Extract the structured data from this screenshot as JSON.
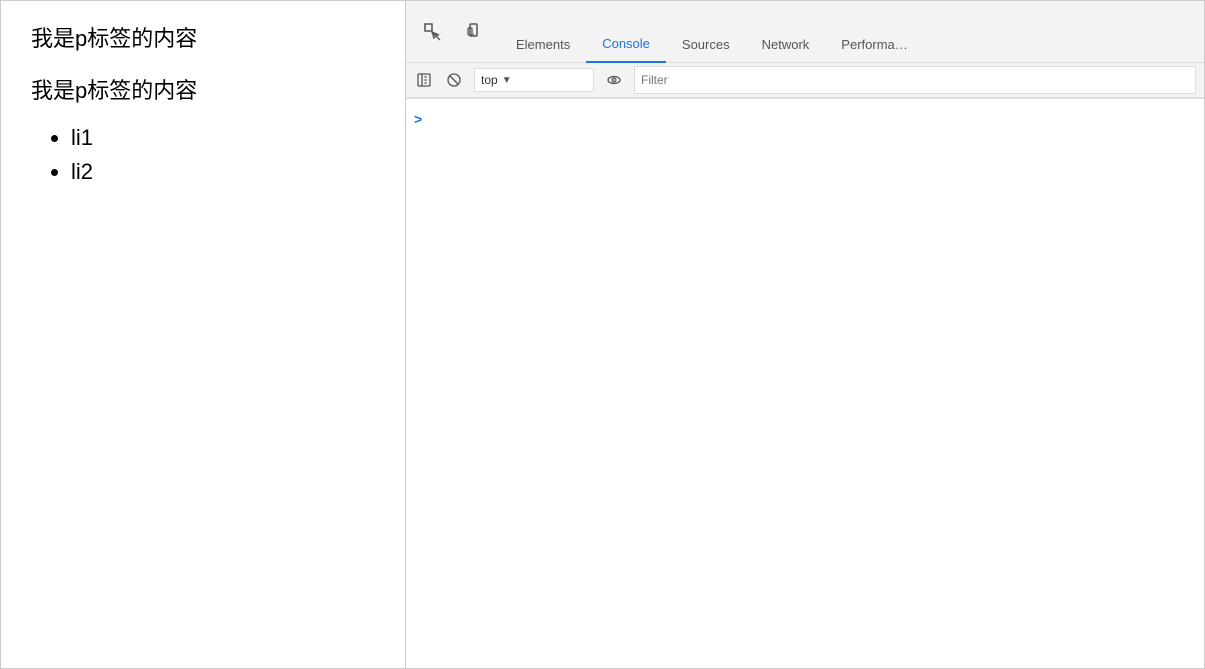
{
  "webpage": {
    "paragraph1": "我是p标签的内容",
    "paragraph2": "我是p标签的内容",
    "list_items": [
      "li1",
      "li2"
    ]
  },
  "devtools": {
    "tabs": [
      {
        "id": "elements",
        "label": "Elements",
        "active": false
      },
      {
        "id": "console",
        "label": "Console",
        "active": true
      },
      {
        "id": "sources",
        "label": "Sources",
        "active": false
      },
      {
        "id": "network",
        "label": "Network",
        "active": false
      },
      {
        "id": "performance",
        "label": "Performa…",
        "active": false
      }
    ],
    "toolbar2": {
      "context_value": "top",
      "filter_placeholder": "Filter"
    },
    "console_prompt": ">"
  },
  "icons": {
    "inspect": "⬚",
    "device": "📱",
    "clear": "⊘",
    "dropdown_arrow": "▼",
    "eye": "👁",
    "chevron_right": ">"
  }
}
